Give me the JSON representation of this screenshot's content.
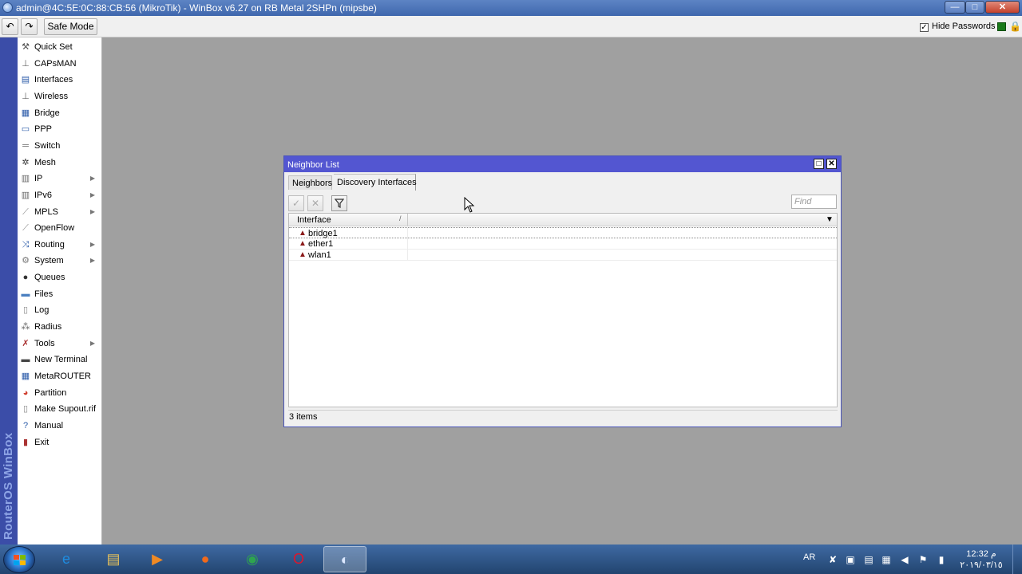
{
  "window": {
    "title": "admin@4C:5E:0C:88:CB:56 (MikroTik) - WinBox v6.27 on RB Metal 2SHPn (mipsbe)",
    "minimize": "—",
    "maximize": "□",
    "close": "✕"
  },
  "toolbar": {
    "undo_icon": "↶",
    "redo_icon": "↷",
    "safe_mode": "Safe Mode",
    "hide_passwords": "Hide Passwords",
    "hide_passwords_checked": "✓",
    "status_color": "#1a7a1a"
  },
  "brand": {
    "vertical_text": "RouterOS WinBox"
  },
  "sidebar": {
    "items": [
      {
        "label": "Quick Set",
        "icon": "quick-set-icon",
        "glyph": "⚒",
        "submenu": false
      },
      {
        "label": "CAPsMAN",
        "icon": "capsman-icon",
        "glyph": "⊥",
        "submenu": false
      },
      {
        "label": "Interfaces",
        "icon": "interfaces-icon",
        "glyph": "▤",
        "submenu": false
      },
      {
        "label": "Wireless",
        "icon": "wireless-icon",
        "glyph": "⊥",
        "submenu": false
      },
      {
        "label": "Bridge",
        "icon": "bridge-icon",
        "glyph": "▦",
        "submenu": false
      },
      {
        "label": "PPP",
        "icon": "ppp-icon",
        "glyph": "▭",
        "submenu": false
      },
      {
        "label": "Switch",
        "icon": "switch-icon",
        "glyph": "═",
        "submenu": false
      },
      {
        "label": "Mesh",
        "icon": "mesh-icon",
        "glyph": "✲",
        "submenu": false
      },
      {
        "label": "IP",
        "icon": "ip-icon",
        "glyph": "▥",
        "submenu": true
      },
      {
        "label": "IPv6",
        "icon": "ipv6-icon",
        "glyph": "▥",
        "submenu": true
      },
      {
        "label": "MPLS",
        "icon": "mpls-icon",
        "glyph": "⟋",
        "submenu": true
      },
      {
        "label": "OpenFlow",
        "icon": "openflow-icon",
        "glyph": "⟋",
        "submenu": false
      },
      {
        "label": "Routing",
        "icon": "routing-icon",
        "glyph": "⤨",
        "submenu": true
      },
      {
        "label": "System",
        "icon": "system-icon",
        "glyph": "⚙",
        "submenu": true
      },
      {
        "label": "Queues",
        "icon": "queues-icon",
        "glyph": "●",
        "submenu": false
      },
      {
        "label": "Files",
        "icon": "files-icon",
        "glyph": "▬",
        "submenu": false
      },
      {
        "label": "Log",
        "icon": "log-icon",
        "glyph": "▯",
        "submenu": false
      },
      {
        "label": "Radius",
        "icon": "radius-icon",
        "glyph": "⁂",
        "submenu": false
      },
      {
        "label": "Tools",
        "icon": "tools-icon",
        "glyph": "✗",
        "submenu": true
      },
      {
        "label": "New Terminal",
        "icon": "terminal-icon",
        "glyph": "▬",
        "submenu": false
      },
      {
        "label": "MetaROUTER",
        "icon": "metarouter-icon",
        "glyph": "▦",
        "submenu": false
      },
      {
        "label": "Partition",
        "icon": "partition-icon",
        "glyph": "◕",
        "submenu": false
      },
      {
        "label": "Make Supout.rif",
        "icon": "supout-icon",
        "glyph": "▯",
        "submenu": false
      },
      {
        "label": "Manual",
        "icon": "manual-icon",
        "glyph": "?",
        "submenu": false
      },
      {
        "label": "Exit",
        "icon": "exit-icon",
        "glyph": "▮",
        "submenu": false
      }
    ],
    "submenu_arrow": "▶"
  },
  "neighbor_window": {
    "title": "Neighbor List",
    "tabs": [
      "Neighbors",
      "Discovery Interfaces"
    ],
    "find_placeholder": "Find",
    "tools": {
      "enable": "✓",
      "disable": "✕",
      "filter": "⏷"
    },
    "columns": [
      "Interface"
    ],
    "sort_indicator": "/",
    "dropdown_icon": "▼",
    "rows": [
      {
        "interface": "bridge1",
        "icon_glyph": "▲"
      },
      {
        "interface": "ether1",
        "icon_glyph": "▲"
      },
      {
        "interface": "wlan1",
        "icon_glyph": "▲"
      }
    ],
    "status": "3 items",
    "maximize_icon": "□",
    "close_icon": "✕"
  },
  "taskbar": {
    "apps": [
      {
        "name": "internet-explorer",
        "glyph": "e",
        "color": "#1e8ce0"
      },
      {
        "name": "file-explorer",
        "glyph": "▤",
        "color": "#e8c25a"
      },
      {
        "name": "media-player",
        "glyph": "▶",
        "color": "#f08a24"
      },
      {
        "name": "firefox",
        "glyph": "●",
        "color": "#f06a1c"
      },
      {
        "name": "chrome",
        "glyph": "◉",
        "color": "#2ea44f"
      },
      {
        "name": "opera",
        "glyph": "O",
        "color": "#e0152a"
      },
      {
        "name": "winbox",
        "glyph": "◐",
        "color": "#dbe8ff"
      }
    ],
    "lang": "AR",
    "time": "12:32 م",
    "date": "٢٠١٩/٠٣/١٥"
  }
}
